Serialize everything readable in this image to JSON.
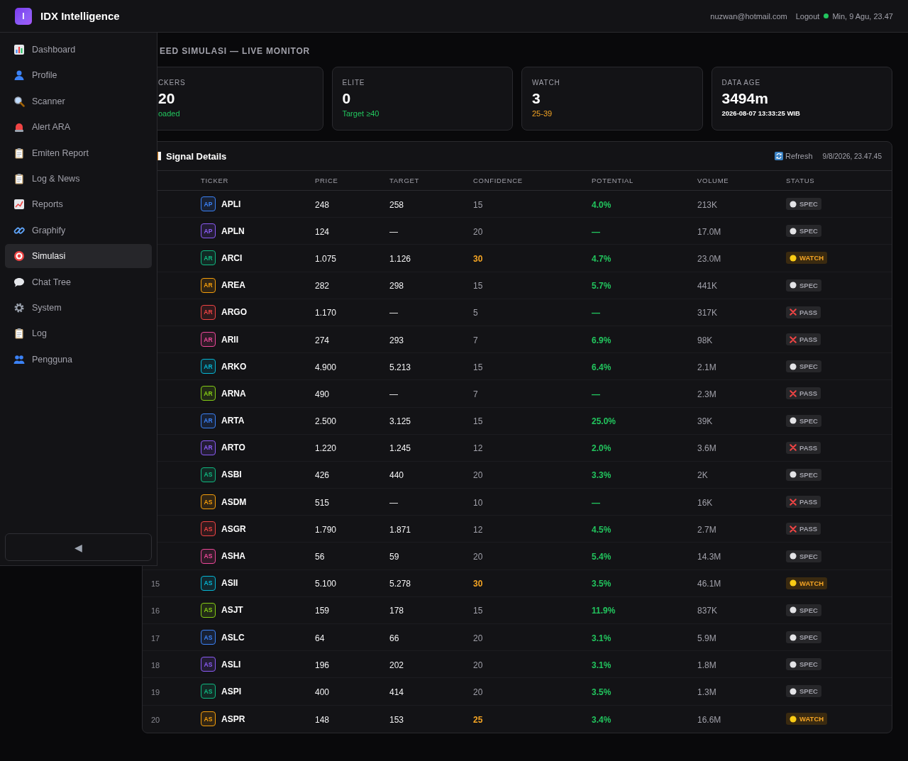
{
  "app": {
    "logo_letter": "I",
    "title": "IDX Intelligence"
  },
  "header": {
    "email": "nuzwan@hotmail.com",
    "logout": "Logout",
    "online": true,
    "datetime": "Min, 9 Agu, 23.47"
  },
  "sidebar": {
    "items": [
      {
        "label": "Dashboard",
        "selected": false
      },
      {
        "label": "Profile",
        "selected": false
      },
      {
        "label": "Scanner",
        "selected": false
      },
      {
        "label": "Alert ARA",
        "selected": false
      },
      {
        "label": "Emiten Report",
        "selected": false
      },
      {
        "label": "Log & News",
        "selected": false
      },
      {
        "label": "Reports",
        "selected": false
      },
      {
        "label": "Graphify",
        "selected": false
      },
      {
        "label": "Simulasi",
        "selected": true
      },
      {
        "label": "Chat Tree",
        "selected": false
      },
      {
        "label": "System",
        "selected": false
      },
      {
        "label": "Log",
        "selected": false
      },
      {
        "label": "Pengguna",
        "selected": false
      }
    ],
    "collapse": "◀"
  },
  "page_title": "EED SIMULASI — LIVE MONITOR",
  "stats": [
    {
      "label": "CKERS",
      "value": "20",
      "note": "oaded",
      "color": "#22c55e"
    },
    {
      "label": "ELITE",
      "value": "0",
      "note": "Target ≥40",
      "color": "#22c55e"
    },
    {
      "label": "WATCH",
      "value": "3",
      "note": "25-39",
      "color": "#f5a524"
    },
    {
      "label": "DATA AGE",
      "value": "3494m",
      "note": "2026-08-07 13:33:25 WIB",
      "color": "#ffffff"
    }
  ],
  "table": {
    "title": "Signal Details",
    "refresh": "Refresh",
    "updated": "9/8/2026, 23.47.45",
    "columns": [
      "TICKER",
      "PRICE",
      "TARGET",
      "CONFIDENCE",
      "POTENTIAL",
      "VOLUME",
      "STATUS"
    ],
    "rows": [
      {
        "abbr": "AP",
        "color": "#3b82f6",
        "ticker": "APLI",
        "price": "248",
        "target": "258",
        "confidence": "15",
        "confidence_high": false,
        "potential": "4.0%",
        "volume": "213K",
        "status": "SPEC",
        "kind": "spec"
      },
      {
        "abbr": "AP",
        "color": "#8b5cf6",
        "ticker": "APLN",
        "price": "124",
        "target": "—",
        "confidence": "20",
        "confidence_high": false,
        "potential": "—",
        "volume": "17.0M",
        "status": "SPEC",
        "kind": "spec"
      },
      {
        "abbr": "AR",
        "color": "#10b981",
        "ticker": "ARCI",
        "price": "1.075",
        "target": "1.126",
        "confidence": "30",
        "confidence_high": true,
        "potential": "4.7%",
        "volume": "23.0M",
        "status": "WATCH",
        "kind": "watch"
      },
      {
        "abbr": "AR",
        "color": "#f59e0b",
        "ticker": "AREA",
        "price": "282",
        "target": "298",
        "confidence": "15",
        "confidence_high": false,
        "potential": "5.7%",
        "volume": "441K",
        "status": "SPEC",
        "kind": "spec"
      },
      {
        "abbr": "AR",
        "color": "#ef4444",
        "ticker": "ARGO",
        "price": "1.170",
        "target": "—",
        "confidence": "5",
        "confidence_high": false,
        "potential": "—",
        "volume": "317K",
        "status": "PASS",
        "kind": "pass"
      },
      {
        "abbr": "AR",
        "color": "#ec4899",
        "ticker": "ARII",
        "price": "274",
        "target": "293",
        "confidence": "7",
        "confidence_high": false,
        "potential": "6.9%",
        "volume": "98K",
        "status": "PASS",
        "kind": "pass"
      },
      {
        "abbr": "AR",
        "color": "#06b6d4",
        "ticker": "ARKO",
        "price": "4.900",
        "target": "5.213",
        "confidence": "15",
        "confidence_high": false,
        "potential": "6.4%",
        "volume": "2.1M",
        "status": "SPEC",
        "kind": "spec"
      },
      {
        "abbr": "AR",
        "color": "#84cc16",
        "ticker": "ARNA",
        "price": "490",
        "target": "—",
        "confidence": "7",
        "confidence_high": false,
        "potential": "—",
        "volume": "2.3M",
        "status": "PASS",
        "kind": "pass"
      },
      {
        "abbr": "AR",
        "color": "#3b82f6",
        "ticker": "ARTA",
        "price": "2.500",
        "target": "3.125",
        "confidence": "15",
        "confidence_high": false,
        "potential": "25.0%",
        "volume": "39K",
        "status": "SPEC",
        "kind": "spec"
      },
      {
        "abbr": "AR",
        "color": "#8b5cf6",
        "ticker": "ARTO",
        "price": "1.220",
        "target": "1.245",
        "confidence": "12",
        "confidence_high": false,
        "potential": "2.0%",
        "volume": "3.6M",
        "status": "PASS",
        "kind": "pass"
      },
      {
        "abbr": "AS",
        "color": "#10b981",
        "ticker": "ASBI",
        "price": "426",
        "target": "440",
        "confidence": "20",
        "confidence_high": false,
        "potential": "3.3%",
        "volume": "2K",
        "status": "SPEC",
        "kind": "spec"
      },
      {
        "abbr": "AS",
        "color": "#f59e0b",
        "ticker": "ASDM",
        "price": "515",
        "target": "—",
        "confidence": "10",
        "confidence_high": false,
        "potential": "—",
        "volume": "16K",
        "status": "PASS",
        "kind": "pass"
      },
      {
        "abbr": "AS",
        "color": "#ef4444",
        "ticker": "ASGR",
        "price": "1.790",
        "target": "1.871",
        "confidence": "12",
        "confidence_high": false,
        "potential": "4.5%",
        "volume": "2.7M",
        "status": "PASS",
        "kind": "pass"
      },
      {
        "abbr": "AS",
        "color": "#ec4899",
        "ticker": "ASHA",
        "price": "56",
        "target": "59",
        "confidence": "20",
        "confidence_high": false,
        "potential": "5.4%",
        "volume": "14.3M",
        "status": "SPEC",
        "kind": "spec"
      },
      {
        "num": "15",
        "abbr": "AS",
        "color": "#06b6d4",
        "ticker": "ASII",
        "price": "5.100",
        "target": "5.278",
        "confidence": "30",
        "confidence_high": true,
        "potential": "3.5%",
        "volume": "46.1M",
        "status": "WATCH",
        "kind": "watch"
      },
      {
        "num": "16",
        "abbr": "AS",
        "color": "#84cc16",
        "ticker": "ASJT",
        "price": "159",
        "target": "178",
        "confidence": "15",
        "confidence_high": false,
        "potential": "11.9%",
        "volume": "837K",
        "status": "SPEC",
        "kind": "spec"
      },
      {
        "num": "17",
        "abbr": "AS",
        "color": "#3b82f6",
        "ticker": "ASLC",
        "price": "64",
        "target": "66",
        "confidence": "20",
        "confidence_high": false,
        "potential": "3.1%",
        "volume": "5.9M",
        "status": "SPEC",
        "kind": "spec"
      },
      {
        "num": "18",
        "abbr": "AS",
        "color": "#8b5cf6",
        "ticker": "ASLI",
        "price": "196",
        "target": "202",
        "confidence": "20",
        "confidence_high": false,
        "potential": "3.1%",
        "volume": "1.8M",
        "status": "SPEC",
        "kind": "spec"
      },
      {
        "num": "19",
        "abbr": "AS",
        "color": "#10b981",
        "ticker": "ASPI",
        "price": "400",
        "target": "414",
        "confidence": "20",
        "confidence_high": false,
        "potential": "3.5%",
        "volume": "1.3M",
        "status": "SPEC",
        "kind": "spec"
      },
      {
        "num": "20",
        "abbr": "AS",
        "color": "#f59e0b",
        "ticker": "ASPR",
        "price": "148",
        "target": "153",
        "confidence": "25",
        "confidence_high": true,
        "potential": "3.4%",
        "volume": "16.6M",
        "status": "WATCH",
        "kind": "watch"
      }
    ]
  }
}
